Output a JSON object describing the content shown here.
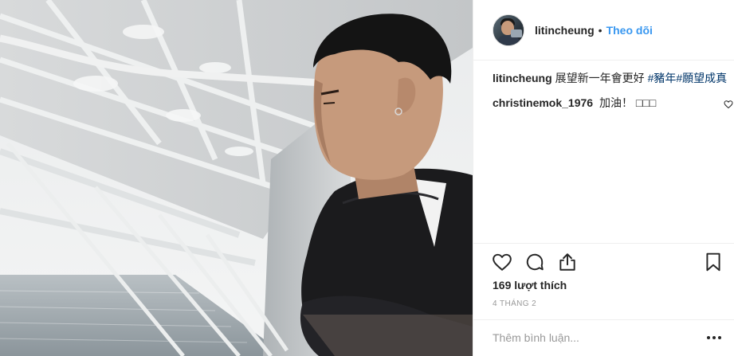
{
  "post": {
    "photo_icon": "photo-person-ship-deck"
  },
  "header": {
    "avatar_icon": "profile-avatar",
    "username": "litincheung",
    "separator": "•",
    "follow_label": "Theo dõi"
  },
  "caption": {
    "username": "litincheung",
    "text": "展望新一年會更好 ",
    "hashtags": "#豬年#願望成真"
  },
  "comments": [
    {
      "username": "christinemok_1976",
      "text": "加油！ □□□"
    }
  ],
  "actions": {
    "like_icon": "heart-icon",
    "comment_icon": "comment-bubble-icon",
    "share_icon": "share-icon",
    "save_icon": "bookmark-icon",
    "likes_text": "169 lượt thích",
    "date": "4 THÁNG 2"
  },
  "add_comment": {
    "placeholder": "Thêm bình luận...",
    "more_icon": "more-options-icon"
  },
  "colors": {
    "link_blue": "#3897f0",
    "hashtag": "#003569",
    "border": "#efefef",
    "muted": "#999999",
    "text": "#262626"
  }
}
